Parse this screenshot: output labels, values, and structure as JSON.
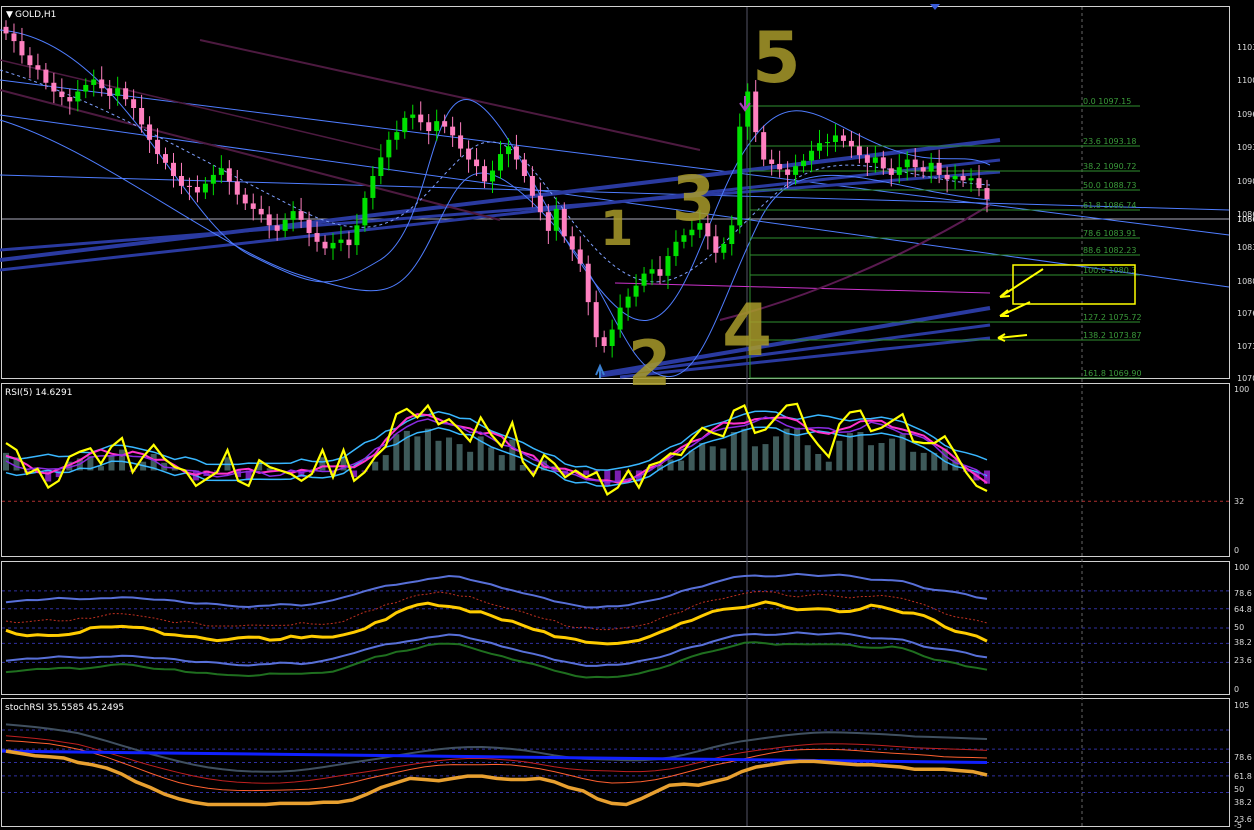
{
  "window": {
    "title": "GOLD,H1"
  },
  "main_panel": {
    "price_scale": [
      "1103.",
      "1100.",
      "1096.",
      "1093.",
      "1090.",
      "1086.",
      "1083.",
      "1080.",
      "1076.",
      "1073.",
      "1070."
    ],
    "current_price_label": "1086.",
    "fib_levels": [
      {
        "pct": "0.0",
        "price": "1097.15"
      },
      {
        "pct": "23.6",
        "price": "1093.18"
      },
      {
        "pct": "38.2",
        "price": "1090.72"
      },
      {
        "pct": "50.0",
        "price": "1088.73"
      },
      {
        "pct": "61.8",
        "price": "1086.74"
      },
      {
        "pct": "78.6",
        "price": "1083.91"
      },
      {
        "pct": "88.6",
        "price": "1082.23"
      },
      {
        "pct": "100.0",
        "price": "1080.3"
      },
      {
        "pct": "127.2",
        "price": "1075.72"
      },
      {
        "pct": "138.2",
        "price": "1073.87"
      },
      {
        "pct": "161.8",
        "price": "1069.90"
      }
    ],
    "wave_labels": [
      "1",
      "2",
      "3",
      "4",
      "5"
    ]
  },
  "rsi_panel": {
    "label": "RSI(5) 14.6291",
    "levels": [
      "100",
      "32",
      "0"
    ]
  },
  "osc_panel": {
    "levels": [
      "100",
      "78.6",
      "64.8",
      "50",
      "38.2",
      "23.6",
      "0"
    ]
  },
  "stoch_panel": {
    "label": "stochRSI 35.5585 45.2495",
    "levels": [
      "105",
      "78.6",
      "61.8",
      "50",
      "38.2",
      "23.6",
      "-5"
    ]
  },
  "colors": {
    "candle_up": "#00e000",
    "candle_down": "#ff80c0",
    "rsi_line": "#ffff00",
    "histogram_neg": "#7a1fb0",
    "histogram_pos": "#3e5a5a",
    "band": "#3a5bd9",
    "fib": "#2f8f2f",
    "annotation": "#a89a2a",
    "stoch_main": "#e8a030"
  },
  "chart_data": {
    "type": "line",
    "title": "GOLD,H1",
    "y_range": [
      1069.9,
      1104
    ],
    "close_prices": [
      1101.5,
      1100.8,
      1099.5,
      1098.6,
      1098.2,
      1097.0,
      1096.2,
      1095.7,
      1095.3,
      1096.2,
      1096.8,
      1097.3,
      1096.5,
      1095.8,
      1096.5,
      1095.5,
      1094.7,
      1093.2,
      1091.8,
      1090.5,
      1089.7,
      1088.5,
      1087.6,
      1087.5,
      1087.0,
      1087.8,
      1088.6,
      1089.2,
      1088.0,
      1086.8,
      1086.0,
      1085.5,
      1085.0,
      1084.0,
      1083.5,
      1084.5,
      1085.3,
      1084.5,
      1083.3,
      1082.5,
      1081.9,
      1082.4,
      1082.7,
      1082.2,
      1084.0,
      1086.5,
      1088.5,
      1090.2,
      1091.8,
      1092.5,
      1093.8,
      1094.1,
      1093.4,
      1092.6,
      1093.5,
      1093.0,
      1092.2,
      1091.0,
      1090.0,
      1089.4,
      1088.0,
      1089.0,
      1090.5,
      1091.2,
      1090.0,
      1088.5,
      1086.7,
      1085.2,
      1083.5,
      1085.5,
      1083.0,
      1081.8,
      1080.5,
      1077.0,
      1073.8,
      1073.0,
      1074.5,
      1076.5,
      1077.5,
      1078.5,
      1079.6,
      1080.0,
      1079.4,
      1081.2,
      1082.5,
      1083.1,
      1083.6,
      1084.2,
      1083.0,
      1081.5,
      1082.3,
      1084.0,
      1093.0,
      1096.2,
      1092.5,
      1090.0,
      1089.6,
      1089.1,
      1088.6,
      1089.4,
      1089.9,
      1090.8,
      1091.5,
      1091.6,
      1092.2,
      1091.7,
      1091.2,
      1090.4,
      1089.7,
      1090.2,
      1089.2,
      1088.6,
      1089.3,
      1090.0,
      1089.3,
      1088.9,
      1089.7,
      1088.6,
      1088.2,
      1088.5,
      1088.1,
      1088.3,
      1087.4,
      1086.4
    ],
    "rsi_values": [
      66,
      62,
      48,
      51,
      40,
      44,
      58,
      61,
      63,
      54,
      64,
      69,
      49,
      58,
      65,
      57,
      52,
      50,
      41,
      45,
      49,
      62,
      44,
      41,
      56,
      52,
      50,
      48,
      44,
      48,
      62,
      46,
      62,
      44,
      49,
      58,
      64,
      83,
      86,
      81,
      88,
      77,
      80,
      74,
      67,
      81,
      71,
      64,
      78,
      55,
      47,
      59,
      54,
      46,
      50,
      46,
      49,
      36,
      40,
      50,
      40,
      53,
      55,
      60,
      59,
      68,
      75,
      72,
      70,
      85,
      88,
      72,
      74,
      81,
      88,
      89,
      73,
      65,
      58,
      77,
      84,
      85,
      73,
      75,
      79,
      83,
      67,
      66,
      66,
      70,
      60,
      49,
      41,
      38
    ],
    "stoch_values": [
      60,
      58,
      56,
      55,
      54,
      50,
      48,
      45,
      40,
      33,
      28,
      22,
      18,
      15,
      13,
      13,
      13,
      13,
      13,
      14,
      14,
      14,
      15,
      15,
      17,
      22,
      28,
      32,
      36,
      35,
      34,
      36,
      38,
      38,
      36,
      35,
      35,
      36,
      33,
      28,
      25,
      18,
      14,
      13,
      18,
      24,
      30,
      31,
      30,
      33,
      36,
      42,
      46,
      48,
      50,
      51,
      51,
      50,
      49,
      48,
      48,
      47,
      46,
      44,
      44,
      44,
      43,
      42,
      39
    ]
  }
}
